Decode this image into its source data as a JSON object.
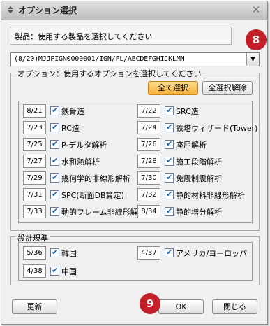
{
  "window": {
    "title": "オプション選択",
    "close_icon": "close-icon"
  },
  "product": {
    "label": "製品：使用する製品を選択してください",
    "selected": "(8/20)MJJPIGN0000001/IGN/FL/ABCDEFGHIJKLMN"
  },
  "callouts": {
    "top": "8",
    "bottom": "9"
  },
  "options": {
    "legend": "オプション：使用するオプションを選択してください",
    "select_all": "全て選択",
    "deselect_all": "全選択解除",
    "left": [
      {
        "code": "8/21",
        "label": "鉄骨造",
        "checked": true
      },
      {
        "code": "7/23",
        "label": "RC造",
        "checked": true
      },
      {
        "code": "7/25",
        "label": "P-デルタ解析",
        "checked": true
      },
      {
        "code": "7/27",
        "label": "水和熱解析",
        "checked": true
      },
      {
        "code": "7/29",
        "label": "幾何学的非線形解析",
        "checked": true
      },
      {
        "code": "7/31",
        "label": "SPC(断面DB算定)",
        "checked": true
      },
      {
        "code": "7/33",
        "label": "動的フレーム非線形解析",
        "checked": true
      }
    ],
    "right": [
      {
        "code": "7/22",
        "label": "SRC造",
        "checked": true
      },
      {
        "code": "7/24",
        "label": "鉄塔ウィザード(Tower)",
        "checked": true
      },
      {
        "code": "7/26",
        "label": "座屈解析",
        "checked": true
      },
      {
        "code": "7/28",
        "label": "施工段階解析",
        "checked": true
      },
      {
        "code": "7/30",
        "label": "免震制震解析",
        "checked": true
      },
      {
        "code": "7/32",
        "label": "静的材料非線形解析",
        "checked": true
      },
      {
        "code": "8/34",
        "label": "静的増分解析",
        "checked": true
      }
    ]
  },
  "design_codes": {
    "legend": "設計規準",
    "items": [
      {
        "code": "5/36",
        "label": "韓国",
        "checked": true
      },
      {
        "code": "4/37",
        "label": "アメリカ/ヨーロッパ",
        "checked": true
      },
      {
        "code": "4/38",
        "label": "中国",
        "checked": true
      }
    ]
  },
  "footer": {
    "update": "更新",
    "ok": "OK",
    "close": "閉じる"
  },
  "colors": {
    "badge": "#c3202a",
    "select_all_button": "#f7b13b",
    "checkmark": "#1c5fb5"
  }
}
